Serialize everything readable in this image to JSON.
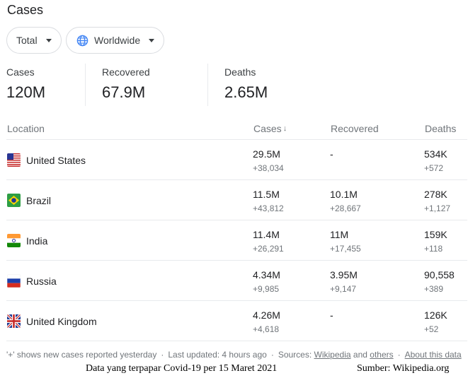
{
  "title": "Cases",
  "filters": {
    "total_label": "Total",
    "region_label": "Worldwide"
  },
  "summary": {
    "cases_label": "Cases",
    "cases_value": "120M",
    "recovered_label": "Recovered",
    "recovered_value": "67.9M",
    "deaths_label": "Deaths",
    "deaths_value": "2.65M"
  },
  "table": {
    "headers": {
      "location": "Location",
      "cases": "Cases",
      "recovered": "Recovered",
      "deaths": "Deaths"
    },
    "rows": [
      {
        "country": "United States",
        "cases": "29.5M",
        "cases_new": "+38,034",
        "recovered": "-",
        "recovered_new": "",
        "deaths": "534K",
        "deaths_new": "+572"
      },
      {
        "country": "Brazil",
        "cases": "11.5M",
        "cases_new": "+43,812",
        "recovered": "10.1M",
        "recovered_new": "+28,667",
        "deaths": "278K",
        "deaths_new": "+1,127"
      },
      {
        "country": "India",
        "cases": "11.4M",
        "cases_new": "+26,291",
        "recovered": "11M",
        "recovered_new": "+17,455",
        "deaths": "159K",
        "deaths_new": "+118"
      },
      {
        "country": "Russia",
        "cases": "4.34M",
        "cases_new": "+9,985",
        "recovered": "3.95M",
        "recovered_new": "+9,147",
        "deaths": "90,558",
        "deaths_new": "+389"
      },
      {
        "country": "United Kingdom",
        "cases": "4.26M",
        "cases_new": "+4,618",
        "recovered": "-",
        "recovered_new": "",
        "deaths": "126K",
        "deaths_new": "+52"
      }
    ]
  },
  "footer": {
    "note": "'+' shows new cases reported yesterday",
    "updated": "Last updated: 4 hours ago",
    "sources_label": "Sources:",
    "source_link1": "Wikipedia",
    "and": "and",
    "source_link2": "others",
    "about": "About this data"
  },
  "caption": {
    "left": "Data yang terpapar Covid-19 per 15 Maret 2021",
    "right": "Sumber: Wikipedia.org"
  },
  "colors": {
    "accent_blue": "#4285f4",
    "divider": "#e8eaed",
    "muted_text": "#70757a"
  }
}
